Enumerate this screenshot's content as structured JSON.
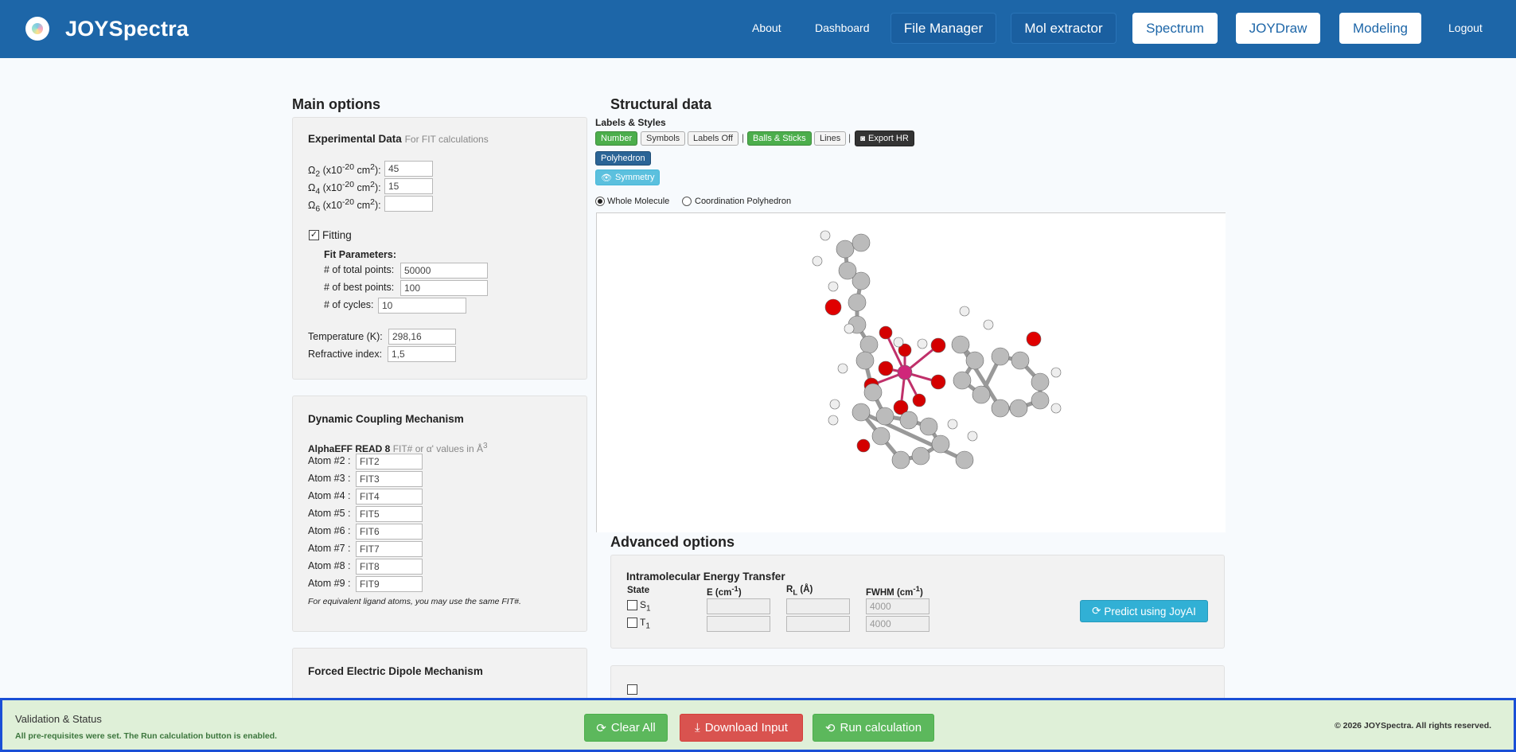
{
  "brand": {
    "name": "JOYSpectra",
    "logo_icon": "spectrum-logo-icon"
  },
  "nav": {
    "about": "About",
    "dashboard": "Dashboard",
    "file_manager": "File Manager",
    "mol_extractor": "Mol extractor",
    "spectrum": "Spectrum",
    "joydraw": "JOYDraw",
    "modeling": "Modeling",
    "logout": "Logout"
  },
  "main_options": {
    "title": "Main options",
    "experimental": {
      "heading": "Experimental Data",
      "hint": "For FIT calculations",
      "omega_prefix": "Ω",
      "omega2_sub": "2",
      "omega4_sub": "4",
      "omega6_sub": "6",
      "unit_mid": " (x10",
      "unit_exp": "-20",
      "unit_cm": " cm",
      "unit_sq": "2",
      "unit_end": "):",
      "omega2_value": "45",
      "omega4_value": "15",
      "omega6_value": ""
    },
    "fitting": {
      "label": "Fitting",
      "checked": true,
      "params_heading": "Fit Parameters:",
      "total_points_label": "# of total points:",
      "total_points_value": "50000",
      "best_points_label": "# of best points:",
      "best_points_value": "100",
      "cycles_label": "# of cycles:",
      "cycles_value": "10"
    },
    "temperature_label": "Temperature (K):",
    "temperature_value": "298,16",
    "refractive_label": "Refractive index:",
    "refractive_value": "1,5"
  },
  "dynamic_coupling": {
    "heading": "Dynamic Coupling Mechanism",
    "alpha_label": "AlphaEFF READ 8",
    "alpha_hint": "FIT# or α' values in Å",
    "alpha_hint_exp": "3",
    "atoms": [
      {
        "label": "Atom #2 :",
        "value": "FIT2"
      },
      {
        "label": "Atom #3 :",
        "value": "FIT3"
      },
      {
        "label": "Atom #4 :",
        "value": "FIT4"
      },
      {
        "label": "Atom #5 :",
        "value": "FIT5"
      },
      {
        "label": "Atom #6 :",
        "value": "FIT6"
      },
      {
        "label": "Atom #7 :",
        "value": "FIT7"
      },
      {
        "label": "Atom #8 :",
        "value": "FIT8"
      },
      {
        "label": "Atom #9 :",
        "value": "FIT9"
      }
    ],
    "note": "For equivalent ligand atoms, you may use the same FIT#."
  },
  "forced_electric": {
    "heading": "Forced Electric Dipole Mechanism"
  },
  "structural": {
    "title": "Structural data",
    "labels_styles": "Labels & Styles",
    "buttons": {
      "number": "Number",
      "symbols": "Symbols",
      "labels_off": "Labels Off",
      "balls_sticks": "Balls & Sticks",
      "lines": "Lines",
      "export_hr": "Export HR",
      "polyhedron": "Polyhedron",
      "symmetry": "Symmetry"
    },
    "separator": "|",
    "view_whole": "Whole Molecule",
    "view_coord": "Coordination Polyhedron",
    "selected_view": "whole"
  },
  "advanced": {
    "title": "Advanced options",
    "iet_heading": "Intramolecular Energy Transfer",
    "col_state": "State",
    "col_e": "E (cm",
    "col_e_exp": "-1",
    "col_e_end": ")",
    "col_rl": "R",
    "col_rl_sub": "L",
    "col_rl_end": " (Å)",
    "col_fwhm": "FWHM (cm",
    "col_fwhm_exp": "-1",
    "col_fwhm_end": ")",
    "rows": [
      {
        "state": "S",
        "state_sub": "1",
        "fwhm": "4000"
      },
      {
        "state": "T",
        "state_sub": "1",
        "fwhm": "4000"
      }
    ],
    "predict_button": "Predict using JoyAI"
  },
  "footer": {
    "title": "Validation & Status",
    "message": "All pre-requisites were set. The Run calculation button is enabled.",
    "clear_all": "Clear All",
    "download_input": "Download Input",
    "run_calculation": "Run calculation",
    "copyright": "© 2026 JOYSpectra. All rights reserved."
  },
  "colors": {
    "navbar": "#1d66a8",
    "success": "#5cb85c",
    "danger": "#d9534f",
    "info": "#5bc0de",
    "footer_bg": "#dff0d8",
    "footer_border": "#1a4fd6"
  }
}
